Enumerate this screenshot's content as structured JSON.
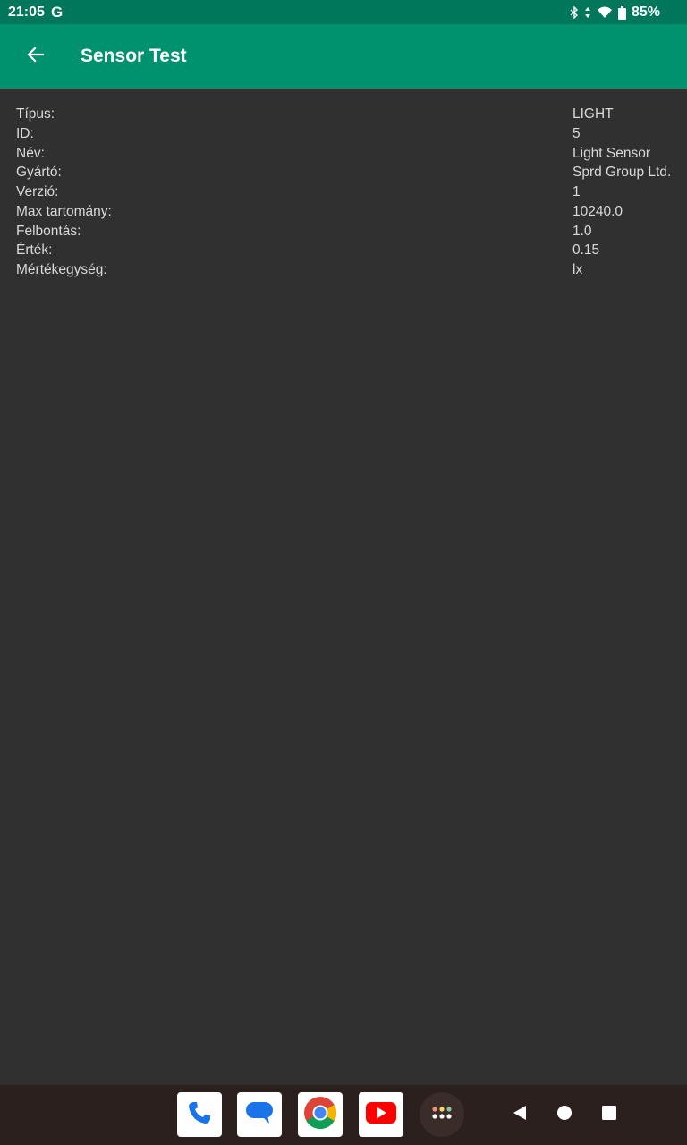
{
  "status_bar": {
    "time": "21:05",
    "g_label": "G",
    "battery": "85%",
    "icons": [
      "bluetooth-icon",
      "data-arrows-icon",
      "wifi-icon",
      "battery-icon"
    ]
  },
  "app_bar": {
    "title": "Sensor Test",
    "back_icon": "arrow-back-icon"
  },
  "sensor_info": [
    {
      "label": "Típus:",
      "value": "LIGHT"
    },
    {
      "label": "ID:",
      "value": "5"
    },
    {
      "label": "Név:",
      "value": "Light Sensor"
    },
    {
      "label": "Gyártó:",
      "value": "Sprd Group Ltd."
    },
    {
      "label": "Verzió:",
      "value": "1"
    },
    {
      "label": "Max tartomány:",
      "value": "10240.0"
    },
    {
      "label": "Felbontás:",
      "value": "1.0"
    },
    {
      "label": "Érték:",
      "value": "0.15"
    },
    {
      "label": "Mértékegység:",
      "value": "lx"
    }
  ],
  "dock": {
    "apps": [
      "phone-icon",
      "messages-icon",
      "chrome-icon",
      "youtube-icon"
    ],
    "app_drawer_icon": "app-drawer-icon"
  },
  "nav_buttons": [
    "back-triangle-icon",
    "home-circle-icon",
    "recents-square-icon"
  ],
  "colors": {
    "status_bar": "#00775a",
    "app_bar": "#00916e",
    "background": "#303030",
    "text": "#d9d9d9",
    "nav_bar": "#2b201d"
  }
}
